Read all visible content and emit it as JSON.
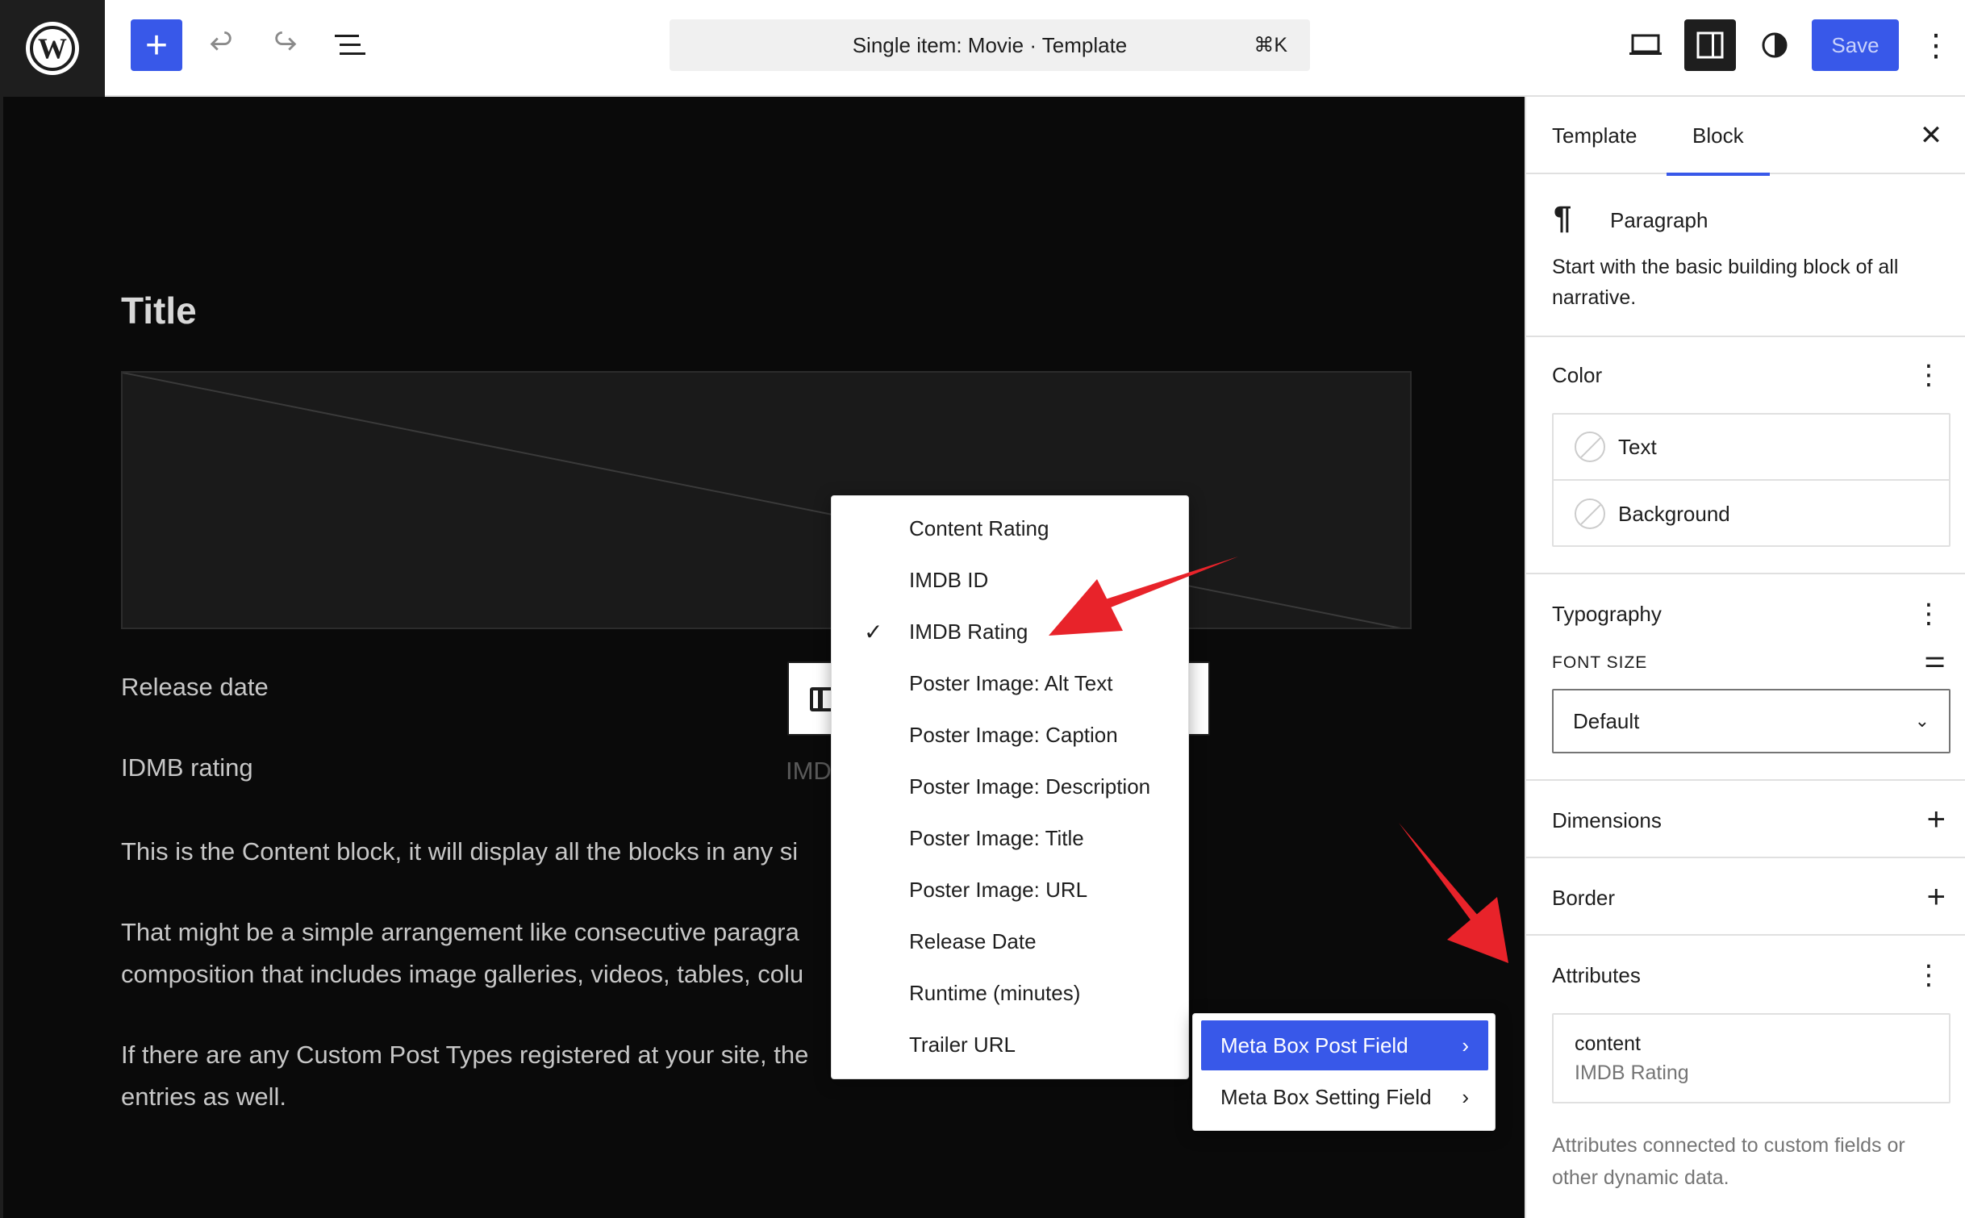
{
  "topbar": {
    "logo_icon": "wordpress-logo",
    "add_icon": "plus-icon",
    "undo_icon": "undo-icon",
    "redo_icon": "redo-icon",
    "list_view_icon": "list-view-icon",
    "command_bar_text": "Single item: Movie · Template",
    "command_shortcut": "⌘K",
    "view_icon": "desktop-view-icon",
    "settings_icon": "settings-sidebar-icon",
    "styles_icon": "styles-contrast-icon",
    "save_label": "Save",
    "more_icon": "more-vertical-icon"
  },
  "canvas": {
    "title": "Title",
    "release_label": "Release date",
    "rating_label": "IDMB rating",
    "rating_fragment": "IMD",
    "para1": "This is the Content block, it will display all the blocks in any si",
    "para2_line1": "That might be a simple arrangement like consecutive paragra                                          laborate",
    "para2_line2": "composition that includes image galleries, videos, tables, colu                                             es.",
    "para3_line1": "If there are any Custom Post Types registered at your site, the",
    "para3_line2": "entries as well."
  },
  "menu": {
    "items": [
      {
        "label": "Content Rating",
        "checked": false
      },
      {
        "label": "IMDB ID",
        "checked": false
      },
      {
        "label": "IMDB Rating",
        "checked": true
      },
      {
        "label": "Poster Image: Alt Text",
        "checked": false
      },
      {
        "label": "Poster Image: Caption",
        "checked": false
      },
      {
        "label": "Poster Image: Description",
        "checked": false
      },
      {
        "label": "Poster Image: Title",
        "checked": false
      },
      {
        "label": "Poster Image: URL",
        "checked": false
      },
      {
        "label": "Release Date",
        "checked": false
      },
      {
        "label": "Runtime (minutes)",
        "checked": false
      },
      {
        "label": "Trailer URL",
        "checked": false
      }
    ],
    "check_glyph": "✓"
  },
  "submenu": {
    "items": [
      {
        "label": "Meta Box Post Field",
        "active": true
      },
      {
        "label": "Meta Box Setting Field",
        "active": false
      }
    ],
    "chevron_glyph": "›"
  },
  "sidebar": {
    "tabs": [
      "Template",
      "Block"
    ],
    "active_tab": "Block",
    "close_glyph": "✕",
    "block": {
      "icon": "paragraph-icon",
      "name": "Paragraph",
      "description": "Start with the basic building block of all narrative."
    },
    "color": {
      "title": "Color",
      "items": [
        "Text",
        "Background"
      ]
    },
    "typography": {
      "title": "Typography",
      "font_size_label": "FONT SIZE",
      "font_size_value": "Default"
    },
    "dimensions": {
      "title": "Dimensions"
    },
    "border": {
      "title": "Border"
    },
    "attributes": {
      "title": "Attributes",
      "key": "content",
      "value": "IMDB Rating",
      "help": "Attributes connected to custom fields or other dynamic data."
    }
  },
  "colors": {
    "accent": "#3858e9",
    "canvas_bg": "#0a0a0a",
    "annotation_arrow": "#e8232a"
  }
}
